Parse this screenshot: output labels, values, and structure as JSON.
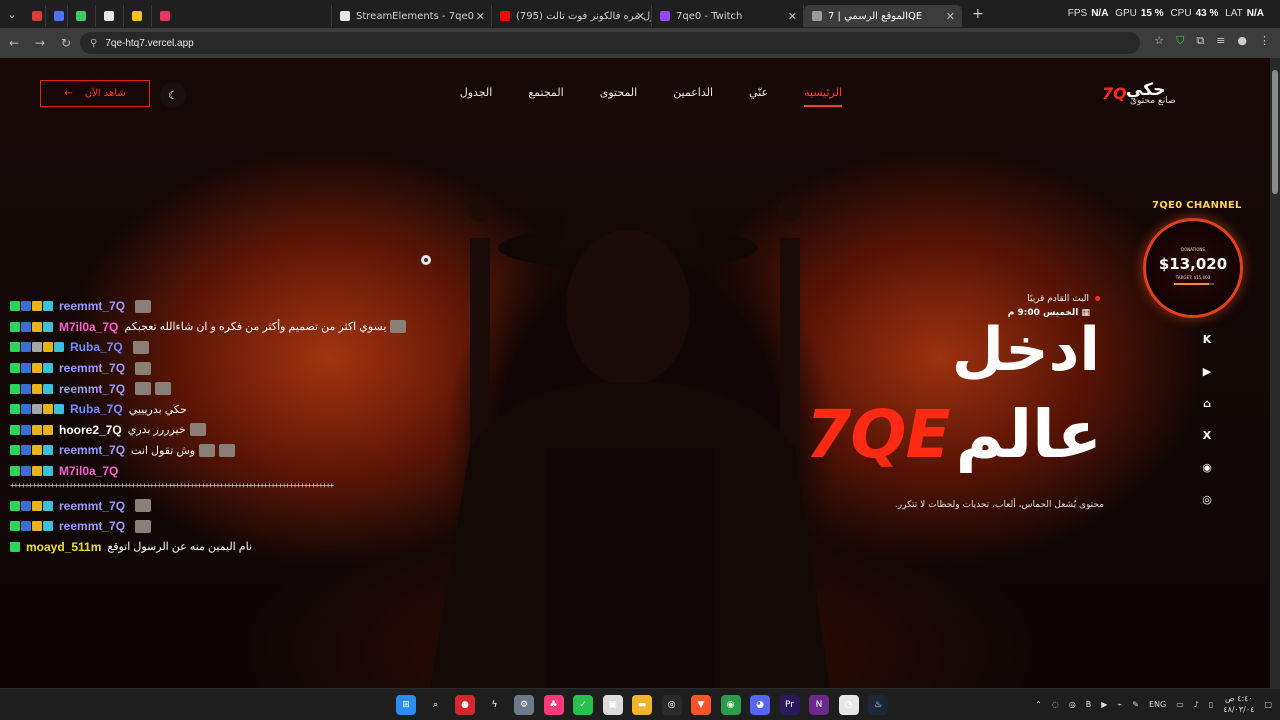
{
  "browser": {
    "tabs": [
      {
        "label": "",
        "color": "#d83b3b"
      },
      {
        "label": "",
        "color": "#4a73ff"
      },
      {
        "label": "",
        "color": "#3ec96a"
      },
      {
        "label": "",
        "color": "#e6e6e6"
      },
      {
        "label": "",
        "color": "#f5c21a"
      },
      {
        "label": "",
        "color": "#e8365d"
      },
      {
        "label": "StreamElements - 7qe0",
        "color": "#e6e6e6"
      },
      {
        "label": "(795) لاول مره فالكونر فوت تالت !",
        "color": "#ff0000"
      },
      {
        "label": "7qe0 - Twitch",
        "color": "#9146ff"
      },
      {
        "label": "الموقع الرسمي | 7QE",
        "color": "#9a9a9a"
      }
    ],
    "new_tab_icon": "+",
    "perf": {
      "fps_label": "FPS",
      "fps": "N/A",
      "gpu_label": "GPU",
      "gpu": "15 %",
      "cpu_label": "CPU",
      "cpu": "43 %",
      "lat_label": "LAT",
      "lat": "N/A"
    },
    "url": "7qe-htq7.vercel.app"
  },
  "site": {
    "logo_mark": "7Q",
    "logo_text": "حكي",
    "logo_sub": "صانع محتوى",
    "nav": [
      "الرئيسية",
      "عنّي",
      "الداعمين",
      "المحتوى",
      "المجتمع",
      "الجدول"
    ],
    "watch_label": "شاهد الآن",
    "watch_arrow": "←",
    "theme_icon": "☾",
    "upcoming_label": "البث القادم قريبًا",
    "schedule": "الخميس 9:00 م",
    "hero_line1": "ادخل",
    "hero_word": "عالم",
    "hero_brand": "7QE",
    "tagline": "محتوى يُشعل الحماس، ألعاب، تحديات ولحظات لا تتكرر.",
    "channel_title": "7QE0 CHANNEL",
    "donation_label": "DONATIONS",
    "donation_amount": "$13,020",
    "donation_target": "TARGET: $15,000",
    "donation_progress": 0.87,
    "socials": [
      "K",
      "▶",
      "⌂",
      "X",
      "◉",
      "◎"
    ]
  },
  "chat": [
    {
      "user": "reemmt_7Q",
      "color": "#9b9bff",
      "text": "",
      "emotes": 1,
      "badges": [
        "#2bd45a",
        "#3a6fd9",
        "#e8b318",
        "#3ac1d9"
      ]
    },
    {
      "user": "M7il0a_7Q",
      "color": "#ff5fd1",
      "text": "يسوي اكثر من تصميم وأكثر من فكره و ان شاءالله تعجبكم",
      "emotes": 1,
      "badges": [
        "#2bd45a",
        "#3a6fd9",
        "#e8b318",
        "#3ac1d9"
      ]
    },
    {
      "user": "Ruba_7Q",
      "color": "#6f8cff",
      "text": "",
      "emotes": 1,
      "badges": [
        "#2bd45a",
        "#3a6fd9",
        "#a6a6a6",
        "#e8b318",
        "#3ac1d9"
      ]
    },
    {
      "user": "reemmt_7Q",
      "color": "#9b9bff",
      "text": "",
      "emotes": 1,
      "badges": [
        "#2bd45a",
        "#3a6fd9",
        "#e8b318",
        "#3ac1d9"
      ]
    },
    {
      "user": "reemmt_7Q",
      "color": "#9b9bff",
      "text": "",
      "emotes": 2,
      "badges": [
        "#2bd45a",
        "#3a6fd9",
        "#e8b318",
        "#3ac1d9"
      ]
    },
    {
      "user": "Ruba_7Q",
      "color": "#6f8cff",
      "text": "حكي بدريييي",
      "emotes": 0,
      "badges": [
        "#2bd45a",
        "#3a6fd9",
        "#a6a6a6",
        "#e8b318",
        "#3ac1d9"
      ]
    },
    {
      "user": "hoore2_7Q",
      "color": "#ffffff",
      "text": "خيرررر بدري",
      "emotes": 1,
      "badges": [
        "#2bd45a",
        "#3a6fd9",
        "#e8b318",
        "#e8b318"
      ]
    },
    {
      "user": "reemmt_7Q",
      "color": "#9b9bff",
      "text": "وش تقول انت",
      "emotes": 2,
      "badges": [
        "#2bd45a",
        "#3a6fd9",
        "#e8b318",
        "#3ac1d9"
      ]
    },
    {
      "user": "M7il0a_7Q",
      "color": "#ff5fd1",
      "text": "",
      "emotes": 0,
      "badges": [
        "#2bd45a",
        "#3a6fd9",
        "#e8b318",
        "#3ac1d9"
      ]
    },
    {
      "divider": "++++++++++++++++++++++++++++++++++++++++++++++++++++++++++++++++++++++++++++++++++++++++"
    },
    {
      "user": "reemmt_7Q",
      "color": "#9b9bff",
      "text": "",
      "emotes": 1,
      "badges": [
        "#2bd45a",
        "#3a6fd9",
        "#e8b318",
        "#3ac1d9"
      ]
    },
    {
      "user": "reemmt_7Q",
      "color": "#9b9bff",
      "text": "",
      "emotes": 1,
      "badges": [
        "#2bd45a",
        "#3a6fd9",
        "#e8b318",
        "#3ac1d9"
      ]
    },
    {
      "user": "moayd_511m",
      "color": "#e8e02a",
      "text": "نام اليمين منه عن الرسول اتوقع",
      "emotes": 0,
      "badges": [
        "#2bd45a"
      ]
    }
  ],
  "taskbar": {
    "apps": [
      {
        "name": "start-icon",
        "color": "#2d8cf0",
        "glyph": "⊞"
      },
      {
        "name": "search-icon",
        "color": "#1e1e1e",
        "glyph": "⌕"
      },
      {
        "name": "app-red-icon",
        "color": "#d8262d",
        "glyph": "●"
      },
      {
        "name": "app-bolt-icon",
        "color": "#1e1e1e",
        "glyph": "ϟ"
      },
      {
        "name": "settings-icon",
        "color": "#6c7a89",
        "glyph": "⚙"
      },
      {
        "name": "app-pink-icon",
        "color": "#ff3a7a",
        "glyph": "♣"
      },
      {
        "name": "app-green-icon",
        "color": "#27c24c",
        "glyph": "✓"
      },
      {
        "name": "app-white-icon",
        "color": "#dcdcdc",
        "glyph": "▣"
      },
      {
        "name": "folder-icon",
        "color": "#f0b429",
        "glyph": "▬"
      },
      {
        "name": "obs-icon",
        "color": "#2a2a2a",
        "glyph": "◎"
      },
      {
        "name": "brave-icon",
        "color": "#fb542b",
        "glyph": "▼"
      },
      {
        "name": "chrome-icon",
        "color": "#2a9d4a",
        "glyph": "◉"
      },
      {
        "name": "discord-icon",
        "color": "#5865f2",
        "glyph": "◕"
      },
      {
        "name": "premiere-icon",
        "color": "#2a1a5a",
        "glyph": "Pr"
      },
      {
        "name": "next-icon",
        "color": "#6a2a8a",
        "glyph": "N"
      },
      {
        "name": "app-circle-icon",
        "color": "#e6e6e6",
        "glyph": "◔"
      },
      {
        "name": "steam-icon",
        "color": "#1b2838",
        "glyph": "♨"
      }
    ],
    "lang": "ENG",
    "time": "٤:٤٠ ص",
    "date": "٤٨/٠٣/٠٤"
  }
}
